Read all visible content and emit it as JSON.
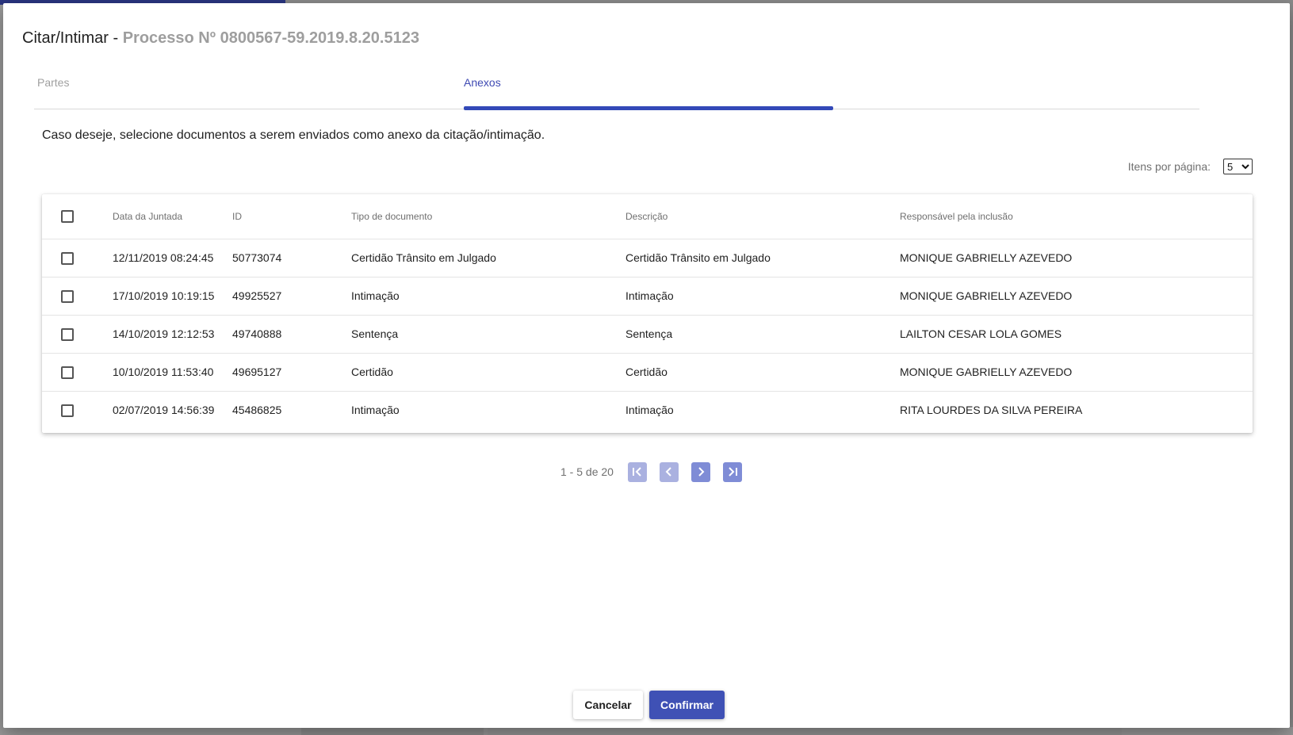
{
  "dialog": {
    "title": "Citar/Intimar",
    "title_separator": "-",
    "process": "Processo Nº 0800567-59.2019.8.20.5123"
  },
  "tabs": [
    {
      "label": "Partes",
      "active": false
    },
    {
      "label": "Anexos",
      "active": true
    }
  ],
  "intro_text": "Caso deseje, selecione documentos a serem enviados como anexo da citação/intimação.",
  "per_page": {
    "label": "Itens por página:",
    "selected": "5"
  },
  "table": {
    "headers": [
      "Data da Juntada",
      "ID",
      "Tipo de documento",
      "Descrição",
      "Responsável pela inclusão"
    ],
    "rows": [
      {
        "date": "12/11/2019 08:24:45",
        "id": "50773074",
        "tipo": "Certidão Trânsito em Julgado",
        "descricao": "Certidão Trânsito em Julgado",
        "responsavel": "MONIQUE GABRIELLY AZEVEDO"
      },
      {
        "date": "17/10/2019 10:19:15",
        "id": "49925527",
        "tipo": "Intimação",
        "descricao": "Intimação",
        "responsavel": "MONIQUE GABRIELLY AZEVEDO"
      },
      {
        "date": "14/10/2019 12:12:53",
        "id": "49740888",
        "tipo": "Sentença",
        "descricao": "Sentença",
        "responsavel": "LAILTON CESAR LOLA GOMES"
      },
      {
        "date": "10/10/2019 11:53:40",
        "id": "49695127",
        "tipo": "Certidão",
        "descricao": "Certidão",
        "responsavel": "MONIQUE GABRIELLY AZEVEDO"
      },
      {
        "date": "02/07/2019 14:56:39",
        "id": "45486825",
        "tipo": "Intimação",
        "descricao": "Intimação",
        "responsavel": "RITA LOURDES DA SILVA PEREIRA"
      }
    ]
  },
  "pagination": {
    "range": "1 - 5 de 20",
    "buttons": [
      "first-page-icon",
      "prev-page-icon",
      "next-page-icon",
      "last-page-icon"
    ]
  },
  "actions": {
    "cancel_label": "Cancelar",
    "confirm_label": "Confirmar"
  },
  "colors": {
    "primary": "#3f51b5",
    "tab_ink": "#3349b8",
    "pager_disabled": "#aab1e0",
    "pager_enabled": "#7f8cd6"
  }
}
